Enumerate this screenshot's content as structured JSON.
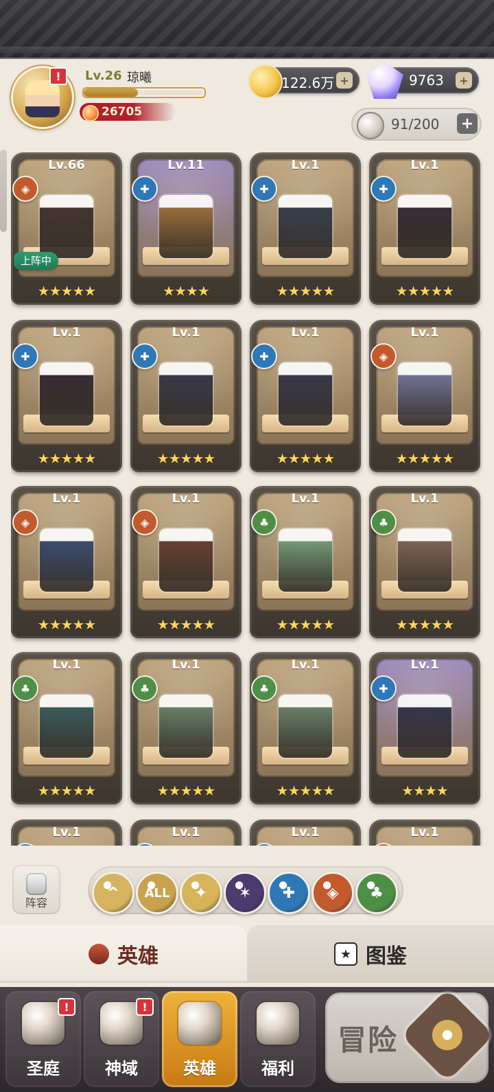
{
  "header": {
    "level": "Lv.26",
    "player_name": "琼曦",
    "power": "26705",
    "gold": "122.6万",
    "diamonds": "9763",
    "stamina": "91/200",
    "alert_mark": "!"
  },
  "heroes": [
    {
      "level": "Lv.66",
      "faction": "beast",
      "stars": "★★★★★",
      "tag": "上阵中",
      "colors": {
        "bg": "#bca27a",
        "spr": "#3b2a2a"
      }
    },
    {
      "level": "Lv.11",
      "faction": "order",
      "stars": "★★★★",
      "tag": "",
      "colors": {
        "bg": "#9c88b9",
        "spr": "#b57a34"
      }
    },
    {
      "level": "Lv.1",
      "faction": "order",
      "stars": "★★★★★",
      "tag": "",
      "colors": {
        "bg": "#bca27a",
        "spr": "#2b3850"
      }
    },
    {
      "level": "Lv.1",
      "faction": "order",
      "stars": "★★★★★",
      "tag": "",
      "colors": {
        "bg": "#bca27a",
        "spr": "#2a1f2f"
      }
    },
    {
      "level": "Lv.1",
      "faction": "order",
      "stars": "★★★★★",
      "tag": "",
      "colors": {
        "bg": "#bca27a",
        "spr": "#2a1f2f"
      }
    },
    {
      "level": "Lv.1",
      "faction": "order",
      "stars": "★★★★★",
      "tag": "",
      "colors": {
        "bg": "#bca27a",
        "spr": "#2b2f4a"
      }
    },
    {
      "level": "Lv.1",
      "faction": "order",
      "stars": "★★★★★",
      "tag": "",
      "colors": {
        "bg": "#bca27a",
        "spr": "#2b2f4a"
      }
    },
    {
      "level": "Lv.1",
      "faction": "beast",
      "stars": "★★★★★",
      "tag": "",
      "colors": {
        "bg": "#bca27a",
        "spr": "#7b7fb6"
      }
    },
    {
      "level": "Lv.1",
      "faction": "beast",
      "stars": "★★★★★",
      "tag": "",
      "colors": {
        "bg": "#bca27a",
        "spr": "#2f4a82"
      }
    },
    {
      "level": "Lv.1",
      "faction": "beast",
      "stars": "★★★★★",
      "tag": "",
      "colors": {
        "bg": "#bca27a",
        "spr": "#6b3a2a"
      }
    },
    {
      "level": "Lv.1",
      "faction": "nature",
      "stars": "★★★★★",
      "tag": "",
      "colors": {
        "bg": "#bca27a",
        "spr": "#7bb58a"
      }
    },
    {
      "level": "Lv.1",
      "faction": "nature",
      "stars": "★★★★★",
      "tag": "",
      "colors": {
        "bg": "#bca27a",
        "spr": "#8a6a5a"
      }
    },
    {
      "level": "Lv.1",
      "faction": "nature",
      "stars": "★★★★★",
      "tag": "",
      "colors": {
        "bg": "#bca27a",
        "spr": "#2d5f63"
      }
    },
    {
      "level": "Lv.1",
      "faction": "nature",
      "stars": "★★★★★",
      "tag": "",
      "colors": {
        "bg": "#bca27a",
        "spr": "#6c8f75"
      }
    },
    {
      "level": "Lv.1",
      "faction": "nature",
      "stars": "★★★★★",
      "tag": "",
      "colors": {
        "bg": "#bca27a",
        "spr": "#6c8f75"
      }
    },
    {
      "level": "Lv.1",
      "faction": "order",
      "stars": "★★★★",
      "tag": "",
      "colors": {
        "bg": "#9c88b9",
        "spr": "#2b2f4a"
      }
    },
    {
      "level": "Lv.1",
      "faction": "order",
      "stars": "",
      "tag": "",
      "colors": {
        "bg": "#bca27a",
        "spr": "#3b2a2a"
      }
    },
    {
      "level": "Lv.1",
      "faction": "order",
      "stars": "",
      "tag": "",
      "colors": {
        "bg": "#bca27a",
        "spr": "#3b2a2a"
      }
    },
    {
      "level": "Lv.1",
      "faction": "order",
      "stars": "",
      "tag": "",
      "colors": {
        "bg": "#bca27a",
        "spr": "#3b2a2a"
      }
    },
    {
      "level": "Lv.1",
      "faction": "beast",
      "stars": "",
      "tag": "",
      "colors": {
        "bg": "#bca27a",
        "spr": "#3b2a2a"
      }
    }
  ],
  "filters": {
    "squad_label": "阵容",
    "buttons": [
      {
        "id": "collapse",
        "text": "^",
        "color": "#d6b35e"
      },
      {
        "id": "all",
        "text": "ALL",
        "color": "#caa24d"
      },
      {
        "id": "light",
        "text": "✦",
        "color": "#d5b45b"
      },
      {
        "id": "dark",
        "text": "✶",
        "color": "#4b3b6e"
      },
      {
        "id": "order",
        "text": "✚",
        "color": "#2e78b7"
      },
      {
        "id": "beast",
        "text": "◈",
        "color": "#c35a2d"
      },
      {
        "id": "nature",
        "text": "♣",
        "color": "#4e8f46"
      }
    ]
  },
  "tabs": {
    "heroes": "英雄",
    "codex": "图鉴",
    "codex_icon": "★"
  },
  "bottom_nav": [
    {
      "label": "圣庭",
      "badge": "!"
    },
    {
      "label": "神域",
      "badge": "!"
    },
    {
      "label": "英雄",
      "badge": ""
    },
    {
      "label": "福利",
      "badge": ""
    }
  ],
  "adventure": {
    "label": "冒险"
  },
  "faction_colors": {
    "beast": "#c35a2d",
    "order": "#2e78b7",
    "nature": "#4e8f46"
  }
}
